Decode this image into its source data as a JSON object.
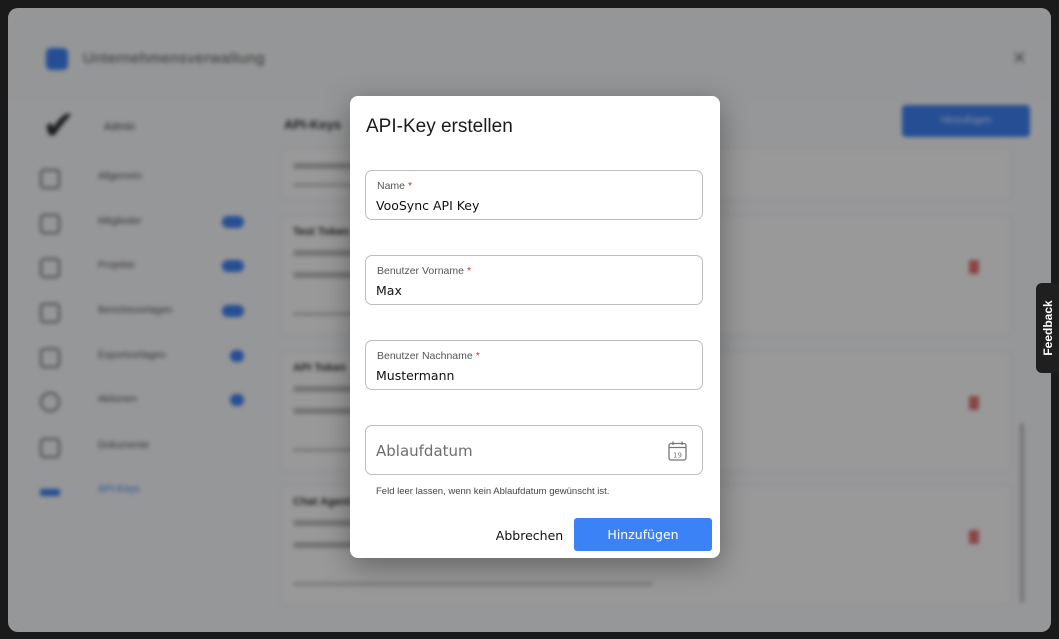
{
  "background": {
    "company_title": "Unternehmensverwaltung",
    "sidebar_title": "Admin",
    "nav": [
      {
        "label": "Allgemein",
        "active": false
      },
      {
        "label": "Mitglieder",
        "active": false
      },
      {
        "label": "Projekte",
        "active": false
      },
      {
        "label": "Berichtsvorlagen",
        "active": false
      },
      {
        "label": "Exportvorlagen",
        "active": false
      },
      {
        "label": "Aktionen",
        "active": false
      },
      {
        "label": "Dokumente",
        "active": false
      },
      {
        "label": "API-Keys",
        "active": true
      }
    ],
    "main_title": "API-Keys",
    "add_button": "Hinzufügen",
    "cards": [
      "Test Token",
      "API Token",
      "Chat Agent"
    ]
  },
  "feedback_tab": "Feedback",
  "dialog": {
    "title": "API-Key erstellen",
    "fields": {
      "name": {
        "label": "Name",
        "value": "VooSync API Key",
        "required": "*"
      },
      "first_name": {
        "label": "Benutzer Vorname",
        "value": "Max",
        "required": "*"
      },
      "last_name": {
        "label": "Benutzer Nachname",
        "value": "Mustermann",
        "required": "*"
      },
      "expiry": {
        "placeholder": "Ablaufdatum",
        "calendar_day": "19"
      }
    },
    "hint": "Feld leer lassen, wenn kein Ablaufdatum gewünscht ist.",
    "cancel_label": "Abbrechen",
    "submit_label": "Hinzufügen",
    "accent_color": "#3b82f6",
    "required_color": "#d32f2f"
  }
}
